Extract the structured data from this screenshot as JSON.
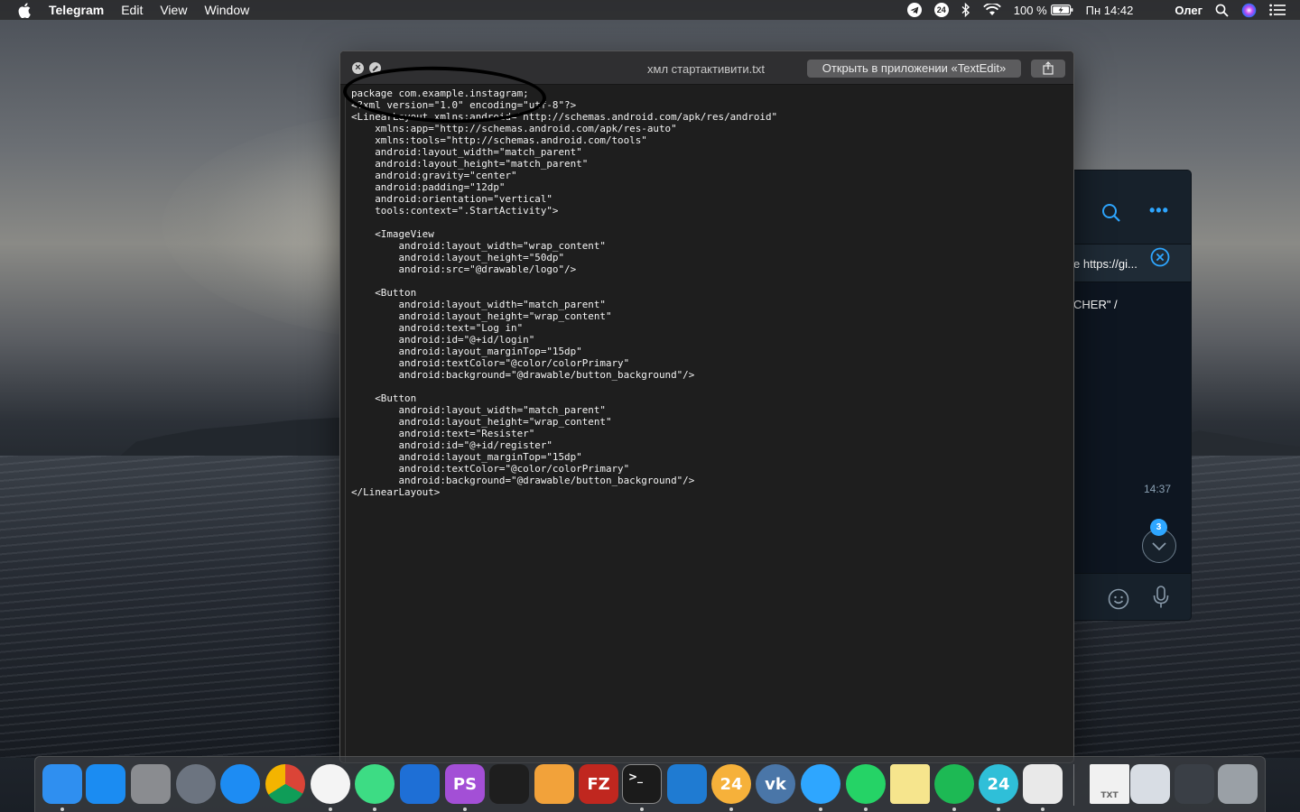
{
  "menubar": {
    "app_name": "Telegram",
    "menus": [
      "Edit",
      "View",
      "Window"
    ],
    "battery": "100 %",
    "clock": "Пн 14:42",
    "user": "Олег",
    "icons": [
      "apple-icon",
      "telegram-status-icon",
      "24-status-icon",
      "bluetooth-icon",
      "wifi-icon",
      "battery-icon",
      "russian-flag-icon",
      "spotlight-icon",
      "siri-icon",
      "notification-center-icon"
    ]
  },
  "quicklook": {
    "file_name": "хмл стартактивити.txt",
    "open_button": "Открыть в приложении «TextEdit»",
    "code_lines": [
      "package com.example.instagram;",
      "<?xml version=\"1.0\" encoding=\"utf-8\"?>",
      "<LinearLayout xmlns:android=\"http://schemas.android.com/apk/res/android\"",
      "    xmlns:app=\"http://schemas.android.com/apk/res-auto\"",
      "    xmlns:tools=\"http://schemas.android.com/tools\"",
      "    android:layout_width=\"match_parent\"",
      "    android:layout_height=\"match_parent\"",
      "    android:gravity=\"center\"",
      "    android:padding=\"12dp\"",
      "    android:orientation=\"vertical\"",
      "    tools:context=\".StartActivity\">",
      "",
      "    <ImageView",
      "        android:layout_width=\"wrap_content\"",
      "        android:layout_height=\"50dp\"",
      "        android:src=\"@drawable/logo\"/>",
      "",
      "    <Button",
      "        android:layout_width=\"match_parent\"",
      "        android:layout_height=\"wrap_content\"",
      "        android:text=\"Log in\"",
      "        android:id=\"@+id/login\"",
      "        android:layout_marginTop=\"15dp\"",
      "        android:textColor=\"@color/colorPrimary\"",
      "        android:background=\"@drawable/button_background\"/>",
      "",
      "    <Button",
      "        android:layout_width=\"match_parent\"",
      "        android:layout_height=\"wrap_content\"",
      "        android:text=\"Resister\"",
      "        android:id=\"@+id/register\"",
      "        android:layout_marginTop=\"15dp\"",
      "        android:textColor=\"@color/colorPrimary\"",
      "        android:background=\"@drawable/button_background\"/>",
      "</LinearLayout>"
    ]
  },
  "telegram": {
    "pinned_text": "e https://gi...",
    "message_text": "CHER\" /",
    "time": "14:37",
    "unread_count": "3",
    "accent": "#2ea6ff"
  },
  "dock": {
    "apps": [
      {
        "name": "finder",
        "color": "#2f8ff0"
      },
      {
        "name": "app-store",
        "color": "#1b8cf2"
      },
      {
        "name": "system-preferences",
        "color": "#8a8c90"
      },
      {
        "name": "launchpad",
        "color": "#6c7480"
      },
      {
        "name": "safari",
        "color": "#1d8cf3"
      },
      {
        "name": "chrome",
        "color": "#e8e8e8"
      },
      {
        "name": "yandex-browser",
        "color": "#f4f4f4"
      },
      {
        "name": "android-studio",
        "color": "#3ddc84"
      },
      {
        "name": "xcode",
        "color": "#1e6fd6"
      },
      {
        "name": "phpstorm",
        "color": "#a34fd6"
      },
      {
        "name": "figma",
        "color": "#1e1e1e"
      },
      {
        "name": "transmit",
        "color": "#f2a23a"
      },
      {
        "name": "filezilla",
        "color": "#c0271f"
      },
      {
        "name": "terminal",
        "color": "#1b1b1b"
      },
      {
        "name": "trello",
        "color": "#1f7bd2"
      },
      {
        "name": "icq-24",
        "color": "#f6b13a"
      },
      {
        "name": "vk",
        "color": "#4a76a8"
      },
      {
        "name": "telegram",
        "color": "#2ea6ff"
      },
      {
        "name": "whatsapp",
        "color": "#25d366"
      },
      {
        "name": "notes",
        "color": "#f6e58d"
      },
      {
        "name": "spotify",
        "color": "#1db954"
      },
      {
        "name": "24-messenger",
        "color": "#2fbfd8"
      },
      {
        "name": "textedit",
        "color": "#e9e9e9"
      },
      {
        "name": "txt-document",
        "color": "#f1f1f1"
      },
      {
        "name": "screenshot-preview",
        "color": "#d8dde4"
      },
      {
        "name": "downloads-stack",
        "color": "#3a3f46"
      },
      {
        "name": "trash",
        "color": "#9aa0a6"
      }
    ],
    "labels": {
      "terminal": ">_",
      "icq-24": "24",
      "24-messenger": "24",
      "phpstorm": "PS",
      "filezilla": "FZ",
      "vk": "vk",
      "txt-document": "TXT"
    }
  }
}
